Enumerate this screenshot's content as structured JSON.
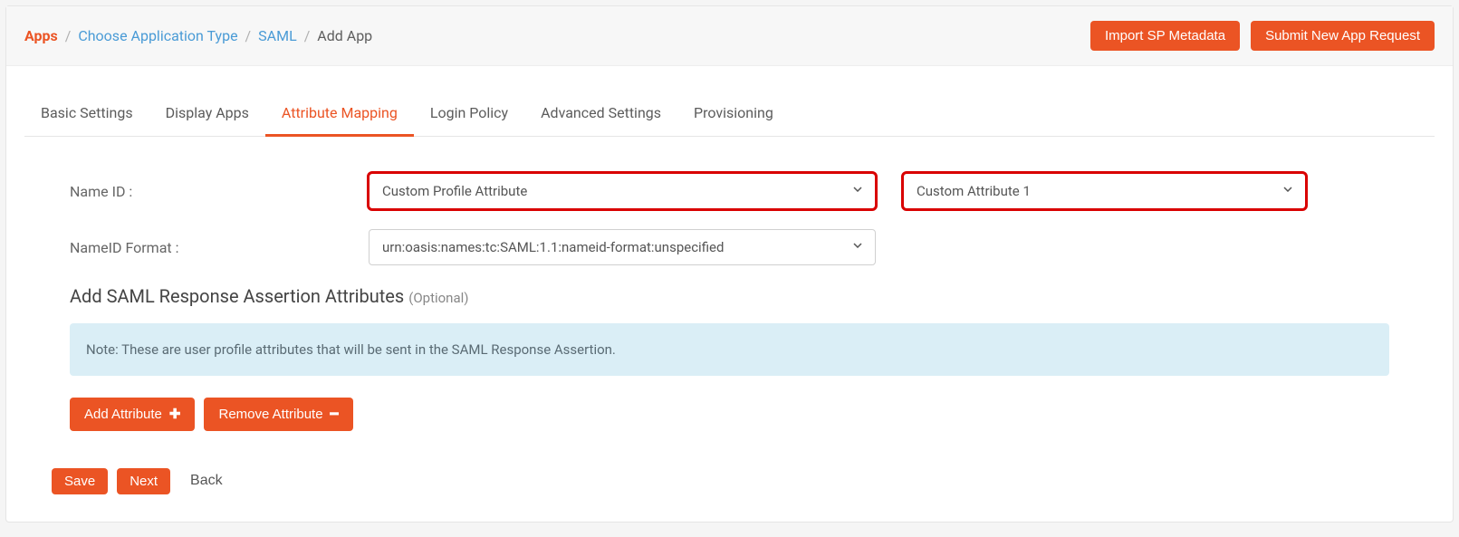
{
  "breadcrumb": {
    "root": "Apps",
    "choose": "Choose Application Type",
    "saml": "SAML",
    "current": "Add App"
  },
  "headerActions": {
    "import": "Import SP Metadata",
    "submit": "Submit New App Request"
  },
  "tabs": {
    "basic": "Basic Settings",
    "display": "Display Apps",
    "attribute": "Attribute Mapping",
    "login": "Login Policy",
    "advanced": "Advanced Settings",
    "provisioning": "Provisioning"
  },
  "form": {
    "nameIdLabel": "Name ID :",
    "nameIdValue": "Custom Profile Attribute",
    "customAttrValue": "Custom Attribute 1",
    "nameIdFormatLabel": "NameID Format :",
    "nameIdFormatValue": "urn:oasis:names:tc:SAML:1.1:nameid-format:unspecified"
  },
  "section": {
    "title": "Add SAML Response Assertion Attributes",
    "optional": "(Optional)",
    "note": "Note: These are user profile attributes that will be sent in the SAML Response Assertion."
  },
  "buttons": {
    "addAttr": "Add Attribute",
    "removeAttr": "Remove Attribute",
    "save": "Save",
    "next": "Next",
    "back": "Back"
  }
}
